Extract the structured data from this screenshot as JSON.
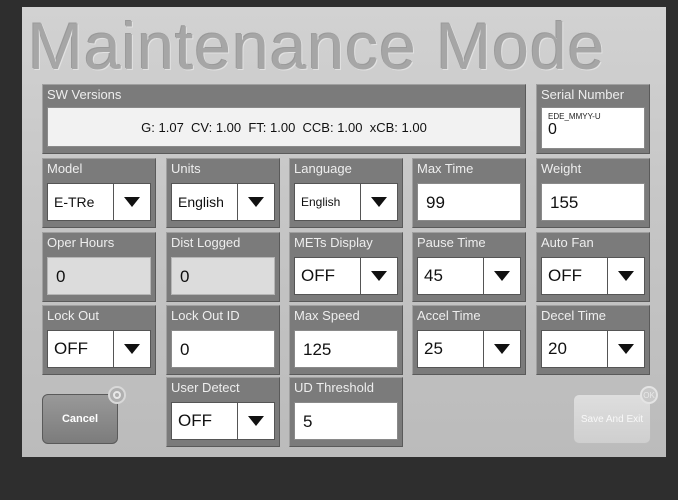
{
  "title": "Maintenance Mode",
  "sw_versions": {
    "label": "SW Versions",
    "value": "G: 1.07  CV: 1.00  FT: 1.00  CCB: 1.00  xCB: 1.00"
  },
  "serial_number": {
    "label": "Serial Number",
    "hint": "EDE_MMYY-U",
    "value": "0"
  },
  "fields": {
    "model": {
      "label": "Model",
      "value": "E-TRe"
    },
    "units": {
      "label": "Units",
      "value": "English"
    },
    "language": {
      "label": "Language",
      "value": "English"
    },
    "max_time": {
      "label": "Max Time",
      "value": "99"
    },
    "weight": {
      "label": "Weight",
      "value": "155"
    },
    "oper_hours": {
      "label": "Oper Hours",
      "value": "0"
    },
    "dist_logged": {
      "label": "Dist Logged",
      "value": "0"
    },
    "mets_display": {
      "label": "METs Display",
      "value": "OFF"
    },
    "pause_time": {
      "label": "Pause Time",
      "value": "45"
    },
    "auto_fan": {
      "label": "Auto Fan",
      "value": "OFF"
    },
    "lock_out": {
      "label": "Lock Out",
      "value": "OFF"
    },
    "lock_out_id": {
      "label": "Lock Out ID",
      "value": "0"
    },
    "max_speed": {
      "label": "Max Speed",
      "value": "125"
    },
    "accel_time": {
      "label": "Accel Time",
      "value": "25"
    },
    "decel_time": {
      "label": "Decel Time",
      "value": "20"
    },
    "user_detect": {
      "label": "User Detect",
      "value": "OFF"
    },
    "ud_threshold": {
      "label": "UD Threshold",
      "value": "5"
    }
  },
  "buttons": {
    "cancel": "Cancel",
    "save_and_exit": "Save And Exit",
    "ok_badge": "OK"
  },
  "taskbar_icons": [
    "home-icon",
    "keypad-icon",
    "screen-icon",
    "device-icon",
    "usb-icon",
    "speaker-icon",
    "volume-level-icon"
  ]
}
